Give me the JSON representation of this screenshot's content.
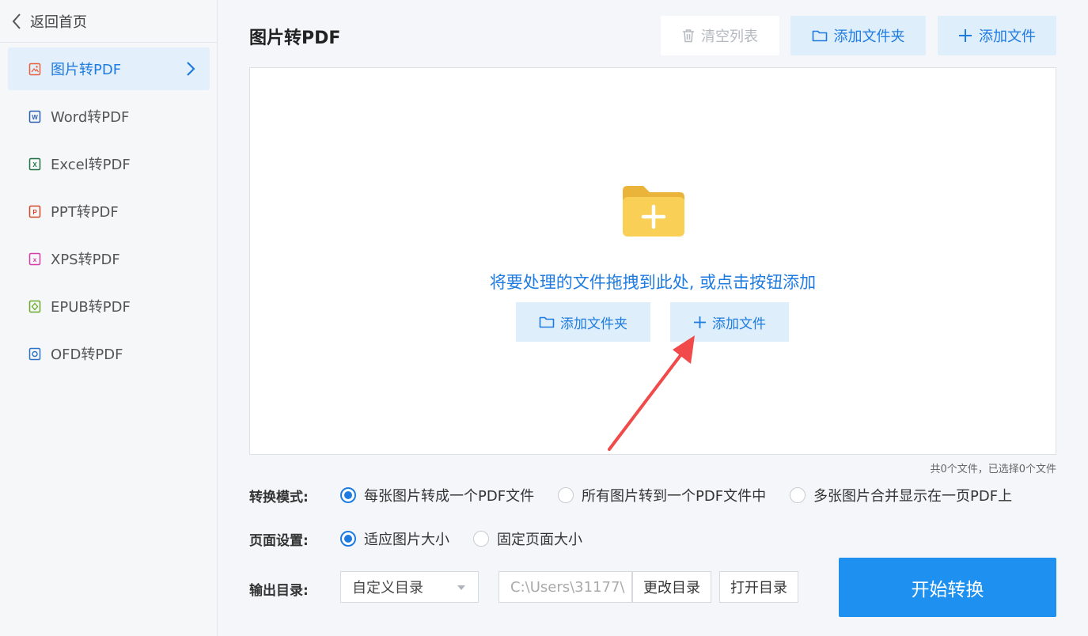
{
  "sidebar": {
    "back_label": "返回首页",
    "items": [
      {
        "label": "图片转PDF",
        "icon": "image-file-icon",
        "color": "#e8603c",
        "active": true
      },
      {
        "label": "Word转PDF",
        "icon": "word-file-icon",
        "color": "#2b5fb4",
        "active": false
      },
      {
        "label": "Excel转PDF",
        "icon": "excel-file-icon",
        "color": "#217346",
        "active": false
      },
      {
        "label": "PPT转PDF",
        "icon": "ppt-file-icon",
        "color": "#d24726",
        "active": false
      },
      {
        "label": "XPS转PDF",
        "icon": "xps-file-icon",
        "color": "#d63aa8",
        "active": false
      },
      {
        "label": "EPUB转PDF",
        "icon": "epub-file-icon",
        "color": "#6aaa2a",
        "active": false
      },
      {
        "label": "OFD转PDF",
        "icon": "ofd-file-icon",
        "color": "#2a73c8",
        "active": false
      }
    ]
  },
  "header": {
    "title": "图片转PDF",
    "clear_label": "清空列表",
    "add_folder_label": "添加文件夹",
    "add_file_label": "添加文件"
  },
  "dropzone": {
    "hint": "将要处理的文件拖拽到此处, 或点击按钮添加",
    "add_folder_label": "添加文件夹",
    "add_file_label": "添加文件"
  },
  "file_count": "共0个文件，已选择0个文件",
  "mode": {
    "label": "转换模式:",
    "options": [
      {
        "label": "每张图片转成一个PDF文件",
        "checked": true
      },
      {
        "label": "所有图片转到一个PDF文件中",
        "checked": false
      },
      {
        "label": "多张图片合并显示在一页PDF上",
        "checked": false
      }
    ]
  },
  "page_setting": {
    "label": "页面设置:",
    "options": [
      {
        "label": "适应图片大小",
        "checked": true
      },
      {
        "label": "固定页面大小",
        "checked": false
      }
    ]
  },
  "output": {
    "label": "输出目录:",
    "select_value": "自定义目录",
    "path_value": "C:\\Users\\31177\\",
    "change_label": "更改目录",
    "open_label": "打开目录"
  },
  "start_label": "开始转换",
  "colors": {
    "accent": "#1e7be0",
    "start": "#1e90f0",
    "arrow": "#f04a4a",
    "folder": "#f9c94a"
  }
}
